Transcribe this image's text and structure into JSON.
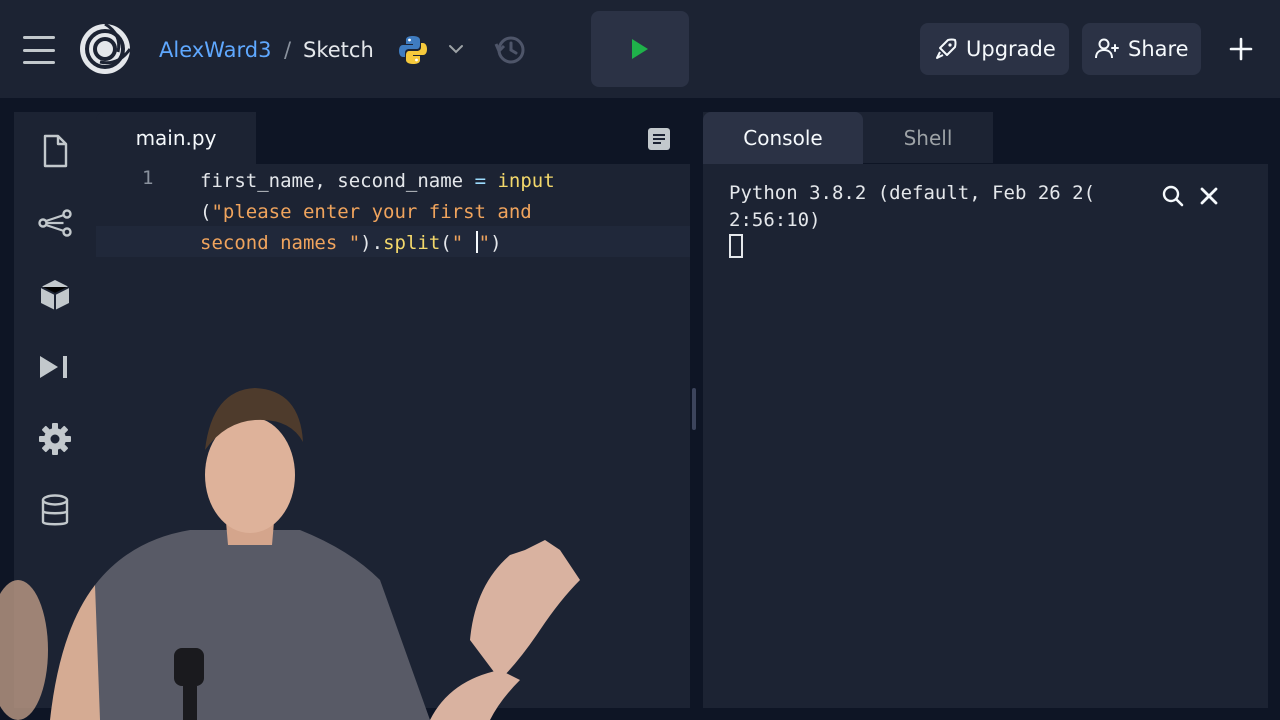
{
  "header": {
    "breadcrumb_user": "AlexWard3",
    "breadcrumb_separator": "/",
    "breadcrumb_project": "Sketch",
    "language_icon": "python-logo-icon",
    "upgrade_label": "Upgrade",
    "share_label": "Share"
  },
  "sidebar": {
    "items": [
      {
        "icon": "files-icon"
      },
      {
        "icon": "version-control-icon"
      },
      {
        "icon": "packages-icon"
      },
      {
        "icon": "debugger-icon"
      },
      {
        "icon": "settings-icon"
      },
      {
        "icon": "database-icon"
      }
    ]
  },
  "editor": {
    "tab_label": "main.py",
    "line_number": "1",
    "code": {
      "id1": "first_name",
      "comma": ", ",
      "id2": "second_name",
      "assign": " = ",
      "fn_input": "input",
      "open1": "(",
      "str1a": "\"please enter your first and",
      "str1b": "second names \"",
      "close1": ")",
      "dot": ".",
      "fn_split": "split",
      "open2": "(",
      "str2": "\" ",
      "str2end": "\"",
      "close2": ")"
    }
  },
  "console": {
    "tab_console": "Console",
    "tab_shell": "Shell",
    "line1": "Python 3.8.2 (default, Feb 26 2(",
    "line2": "2:56:10)"
  },
  "colors": {
    "background": "#0e1525",
    "panel": "#1c2333",
    "link_blue": "#5fa8ff",
    "run_green": "#1fb14a",
    "string_orange": "#f0a45d",
    "function_yellow": "#f3d86b"
  }
}
